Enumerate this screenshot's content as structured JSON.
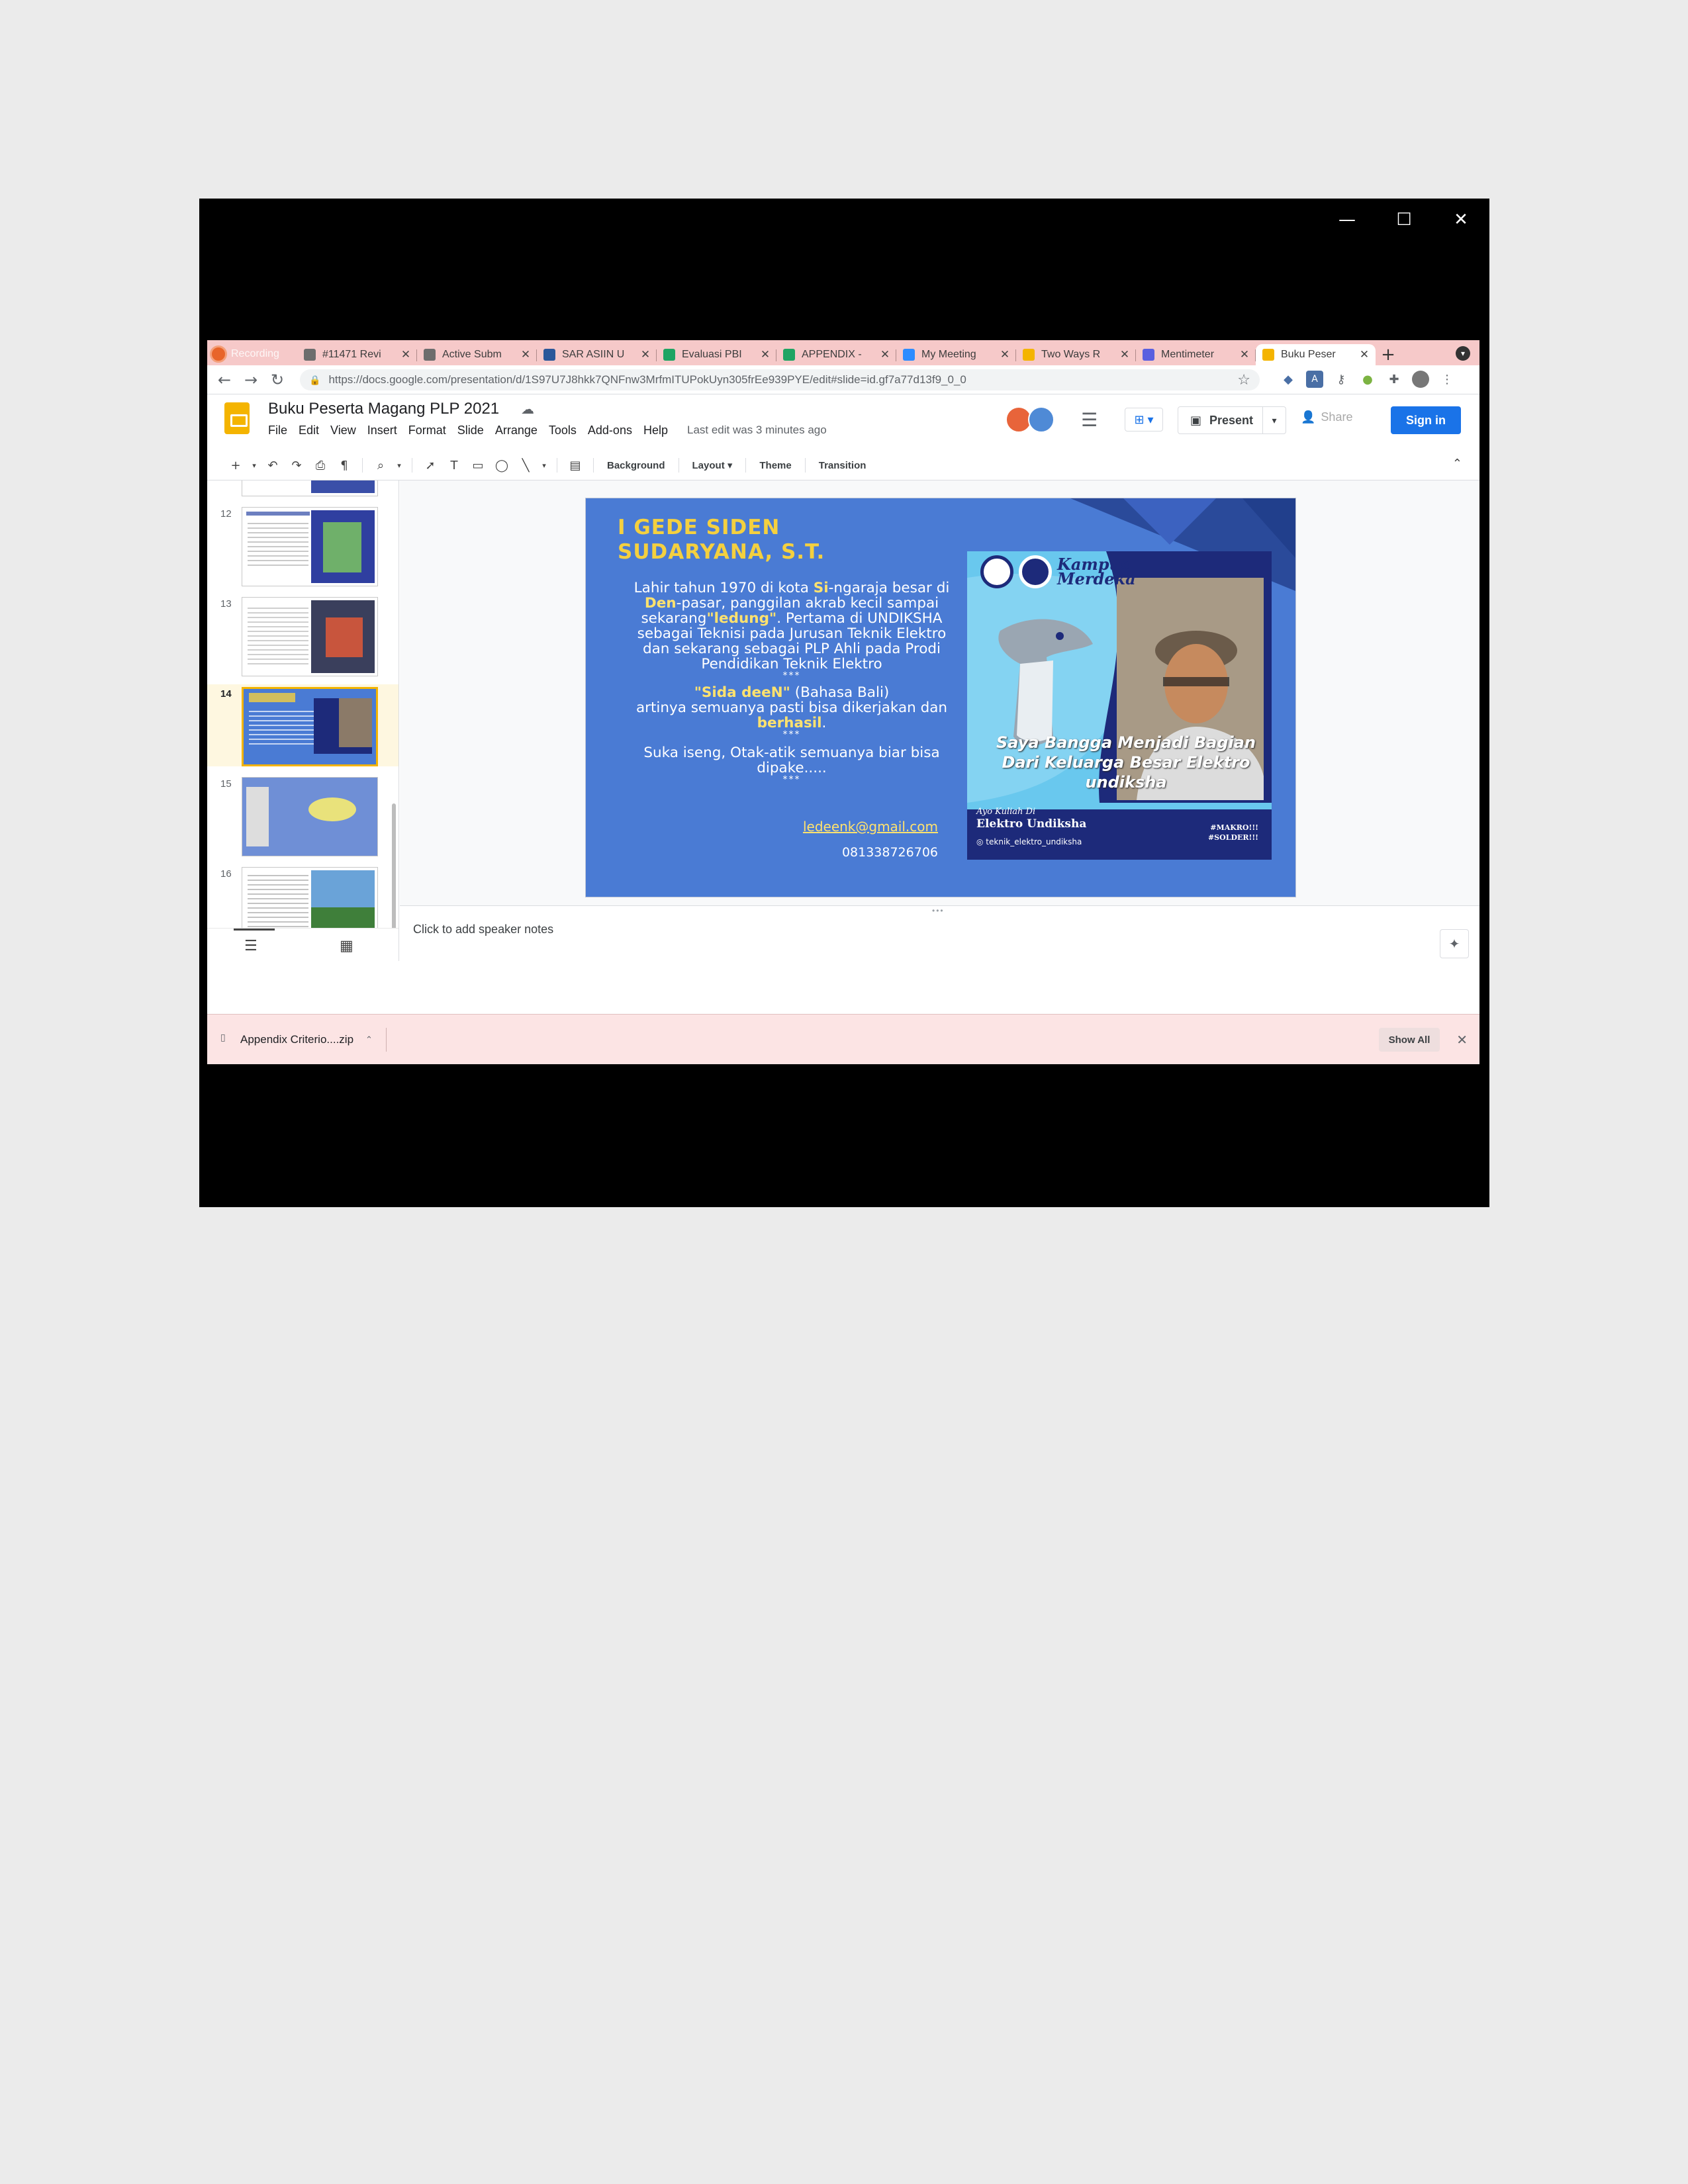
{
  "window": {
    "controls": {
      "minimize": "—",
      "maximize": "☐",
      "close": "✕"
    }
  },
  "recording": {
    "label": "Recording"
  },
  "tabs": [
    {
      "title": "#11471 Revi",
      "close": "✕",
      "color": "#6d6d6d"
    },
    {
      "title": "Active Subm",
      "close": "✕",
      "color": "#6d6d6d"
    },
    {
      "title": "SAR ASIIN U",
      "close": "✕",
      "color": "#2b579a"
    },
    {
      "title": "Evaluasi PBI",
      "close": "✕",
      "color": "#1fa463"
    },
    {
      "title": "APPENDIX -",
      "close": "✕",
      "color": "#1fa463"
    },
    {
      "title": "My Meeting",
      "close": "✕",
      "color": "#2d8cff"
    },
    {
      "title": "Two Ways R",
      "close": "✕",
      "color": "#f4b400"
    },
    {
      "title": "Mentimeter",
      "close": "✕",
      "color": "#5a5fe0"
    },
    {
      "title": "Buku Peser",
      "close": "✕",
      "color": "#f4b400"
    }
  ],
  "browser": {
    "url": "https://docs.google.com/presentation/d/1S97U7J8hkk7QNFnw3MrfmITUPokUyn305frEe939PYE/edit#slide=id.gf7a77d13f9_0_0",
    "new_tab": "+"
  },
  "app": {
    "doc_title": "Buku Peserta Magang PLP 2021",
    "menu": [
      "File",
      "Edit",
      "View",
      "Insert",
      "Format",
      "Slide",
      "Arrange",
      "Tools",
      "Add-ons",
      "Help"
    ],
    "last_edit": "Last edit was 3 minutes ago",
    "present_label": "Present",
    "share_label": "Share",
    "signin_label": "Sign in"
  },
  "toolbar": {
    "background": "Background",
    "layout": "Layout",
    "theme": "Theme",
    "transition": "Transition"
  },
  "filmstrip": {
    "slides": [
      {
        "num": "",
        "kind": "partial"
      },
      {
        "num": "12",
        "kind": "doc-photo"
      },
      {
        "num": "13",
        "kind": "doc-photo"
      },
      {
        "num": "14",
        "kind": "current",
        "selected": true
      },
      {
        "num": "15",
        "kind": "photo-doc"
      },
      {
        "num": "16",
        "kind": "doc-photo"
      }
    ]
  },
  "slide": {
    "title_line1": "I GEDE SIDEN",
    "title_line2": "SUDARYANA, S.T.",
    "para1_a": "Lahir tahun 1970 di kota ",
    "para1_b": "Si",
    "para1_c": "-ngaraja besar di ",
    "para1_d": "Den",
    "para1_e": "-pasar, panggilan akrab kecil sampai sekarang",
    "para1_f": "\"ledung\"",
    "para1_g": ". Pertama di UNDIKSHA sebagai Teknisi pada Jurusan Teknik Elektro dan sekarang sebagai PLP Ahli pada Prodi Pendidikan Teknik Elektro",
    "stars": "***",
    "para2_a": "\"Sida deeN\"",
    "para2_b": " (Bahasa Bali)",
    "para2_c": "artinya semuanya pasti bisa dikerjakan dan ",
    "para2_d": "berhasil",
    "para2_e": ".",
    "para3": "Suka iseng, Otak-atik semuanya biar bisa dipake.....",
    "email": "ledeenk@gmail.com",
    "phone": "081338726706",
    "poster": {
      "brand_line1": "Kampus",
      "brand_line2": "Merdeka",
      "caption": "Saya Bangga Menjadi Bagian Dari Keluarga Besar Elektro undiksha",
      "foot1": "Ayo Kuliah Di",
      "foot2": "Elektro Undiksha",
      "foot3": "teknik_elektro_undiksha",
      "tag1": "#MAKRO!!!",
      "tag2": "#SOLDER!!!"
    }
  },
  "notes": {
    "placeholder": "Click to add speaker notes"
  },
  "downloads": {
    "file": "Appendix Criterio....zip",
    "show_all": "Show All"
  },
  "colors": {
    "accent": "#1a73e8",
    "slide_bg": "#4a7bd4",
    "tabstrip": "#f6c9c9",
    "download_bar": "#fce4e4"
  }
}
